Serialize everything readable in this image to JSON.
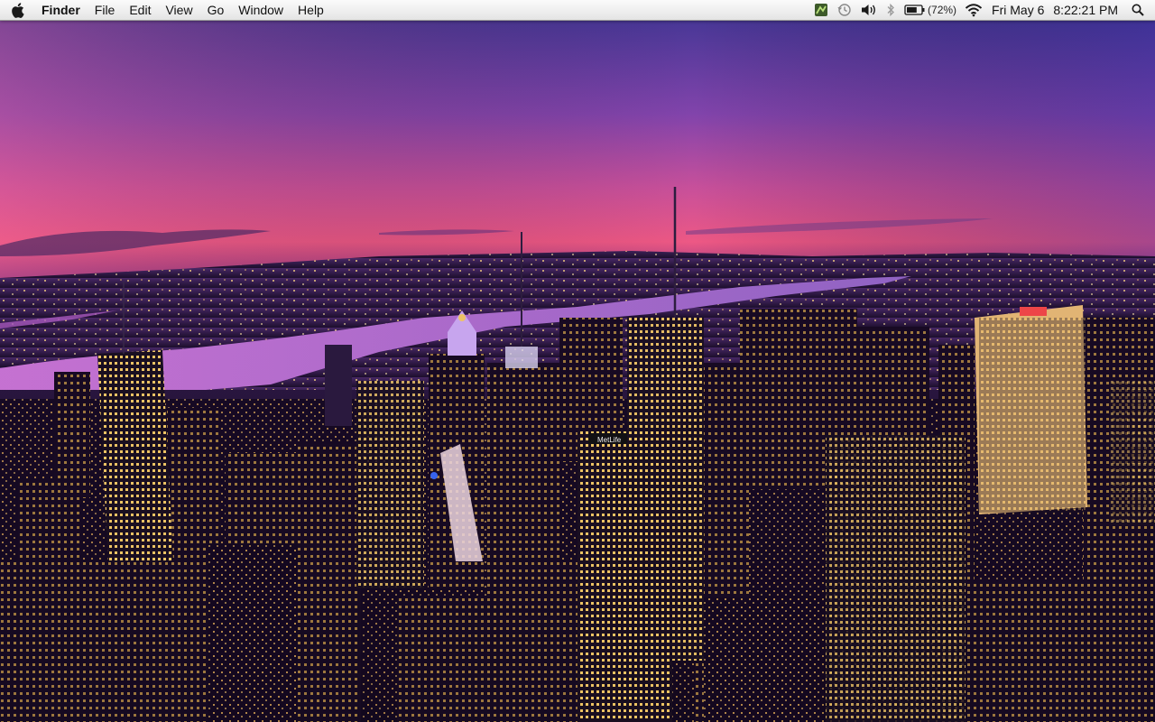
{
  "menubar": {
    "apple_icon": "apple-logo-icon",
    "app_name": "Finder",
    "items": [
      "File",
      "Edit",
      "View",
      "Go",
      "Window",
      "Help"
    ],
    "status": {
      "icons": [
        "app-status-icon",
        "time-machine-icon",
        "volume-icon",
        "bluetooth-icon",
        "battery-icon",
        "wifi-icon",
        "spotlight-icon"
      ],
      "battery_percent": "(72%)",
      "battery_level": 0.72,
      "date": "Fri May 6",
      "time": "8:22:21 PM"
    }
  },
  "desktop": {
    "wallpaper": "new-york-city-skyline-dusk",
    "colors": {
      "sky_top": "#4b3a9e",
      "sky_mid": "#b04aa8",
      "horizon": "#ff5e8c",
      "river": "#c46ad6",
      "city_dark": "#170a22",
      "window_light": "#ffd36a"
    }
  }
}
